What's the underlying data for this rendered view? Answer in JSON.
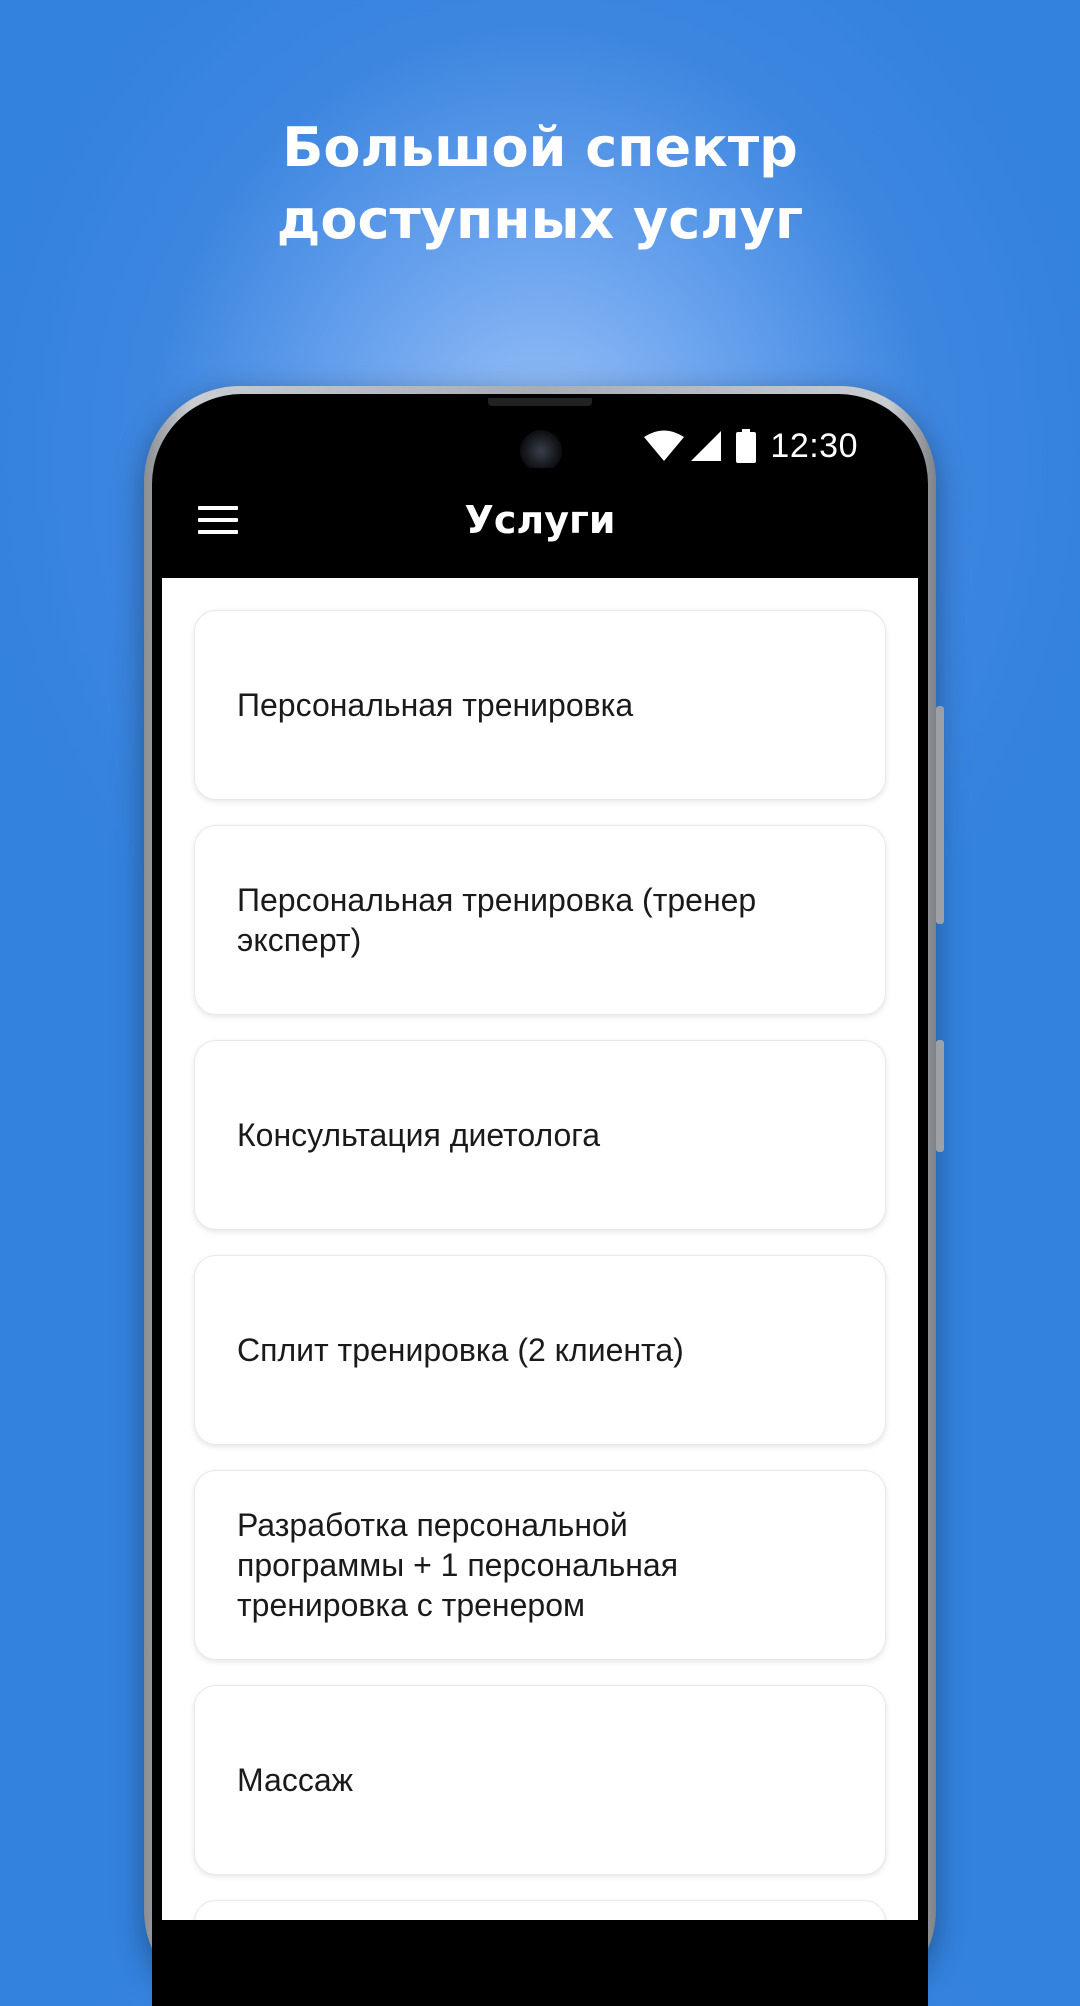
{
  "promo": {
    "title_line1": "Большой спектр",
    "title_line2": "доступных услуг"
  },
  "status_bar": {
    "time": "12:30",
    "icons": [
      "wifi-icon",
      "signal-icon",
      "battery-icon"
    ]
  },
  "app_bar": {
    "title": "Услуги",
    "menu_icon": "menu-icon"
  },
  "services": [
    {
      "label": "Персональная тренировка"
    },
    {
      "label": "Персональная тренировка (тренер эксперт)"
    },
    {
      "label": "Консультация диетолога"
    },
    {
      "label": "Сплит тренировка (2 клиента)"
    },
    {
      "label": "Разработка персональной программы + 1 персональная тренировка с тренером"
    },
    {
      "label": "Массаж"
    },
    {
      "label": ""
    }
  ],
  "colors": {
    "background": "#3382de",
    "app_bar": "#000000",
    "card": "#ffffff",
    "text": "#1a1a1a"
  }
}
